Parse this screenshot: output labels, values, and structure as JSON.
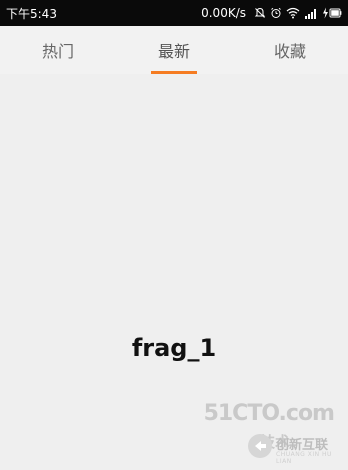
{
  "status_bar": {
    "time": "下午5:43",
    "speed": "0.00K/s",
    "icons": [
      "mute-icon",
      "alarm-icon",
      "wifi-icon",
      "signal-icon",
      "battery-charging-icon"
    ]
  },
  "tabs": [
    {
      "label": "热门",
      "active": false
    },
    {
      "label": "最新",
      "active": true
    },
    {
      "label": "收藏",
      "active": false
    }
  ],
  "accent_color": "#f57c22",
  "content": {
    "fragment_label": "frag_1"
  },
  "watermark": {
    "site": "51CTO.com",
    "tech": "技术",
    "brand": "创新互联",
    "brand_sub": "CHUANG XIN HU LIAN"
  }
}
